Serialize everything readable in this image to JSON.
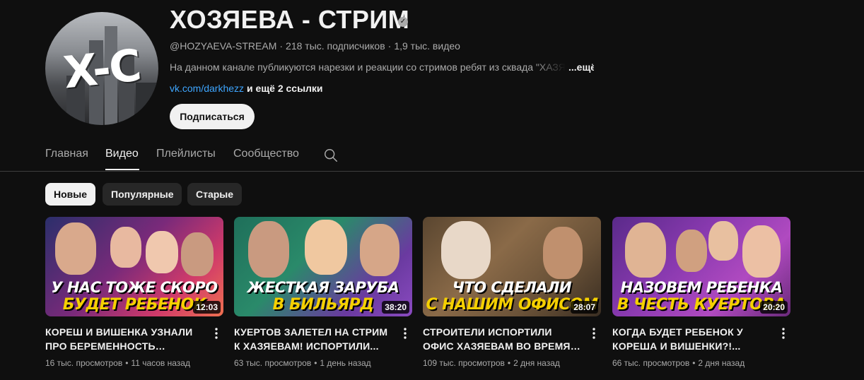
{
  "channel": {
    "title": "ХОЗЯЕВА - СТРИМ",
    "handle": "@HOZYAEVA-STREAM",
    "subscribers": "218 тыс. подписчиков",
    "video_count": "1,9 тыс. видео",
    "description": "На данном канале публикуются нарезки и реакции со стримов ребят из сквада \"ХАЗЯЕВА\"",
    "description_more": "...ещё",
    "link": "vk.com/darkhezz",
    "links_extra": "и ещё 2 ссылки",
    "subscribe_label": "Подписаться",
    "avatar_text": "X-C"
  },
  "tabs": [
    {
      "label": "Главная",
      "active": false
    },
    {
      "label": "Видео",
      "active": true
    },
    {
      "label": "Плейлисты",
      "active": false
    },
    {
      "label": "Сообщество",
      "active": false
    }
  ],
  "chips": [
    {
      "label": "Новые",
      "active": true
    },
    {
      "label": "Популярные",
      "active": false
    },
    {
      "label": "Старые",
      "active": false
    }
  ],
  "videos": [
    {
      "title": "КОРЕШ И ВИШЕНКА УЗНАЛИ ПРО БЕРЕМЕННОСТЬ ДИЛАРЫ И...",
      "views": "16 тыс. просмотров",
      "age": "11 часов назад",
      "duration": "12:03",
      "thumb_line1": "У НАС ТОЖЕ СКОРО",
      "thumb_line2": "БУДЕТ РЕБЕНОК",
      "thumb_accent": "#f5d000"
    },
    {
      "title": "КУЕРТОВ ЗАЛЕТЕЛ НА СТРИМ К ХАЗЯЕВАМ! ИСПОРТИЛИ...",
      "views": "63 тыс. просмотров",
      "age": "1 день назад",
      "duration": "38:20",
      "thumb_line1": "ЖЕСТКАЯ ЗАРУБА",
      "thumb_line2": "В БИЛЬЯРД",
      "thumb_accent": "#f5d000"
    },
    {
      "title": "СТРОИТЕЛИ ИСПОРТИЛИ ОФИС ХАЗЯЕВАМ ВО ВРЕМЯ РЕМОНТА...",
      "views": "109 тыс. просмотров",
      "age": "2 дня назад",
      "duration": "28:07",
      "thumb_line1": "ЧТО СДЕЛАЛИ",
      "thumb_line2": "С НАШИМ ОФИСОМ",
      "thumb_accent": "#f5d000"
    },
    {
      "title": "КОГДА БУДЕТ РЕБЕНОК У КОРЕША И ВИШЕНКИ?!...",
      "views": "66 тыс. просмотров",
      "age": "2 дня назад",
      "duration": "20:20",
      "thumb_line1": "НАЗОВЕМ РЕБЕНКА",
      "thumb_line2": "В ЧЕСТЬ КУЕРТОВА",
      "thumb_accent": "#f5d000"
    }
  ],
  "icons": {
    "verified": "verified-check-icon",
    "search": "search-icon",
    "more": "more-vertical-icon"
  }
}
